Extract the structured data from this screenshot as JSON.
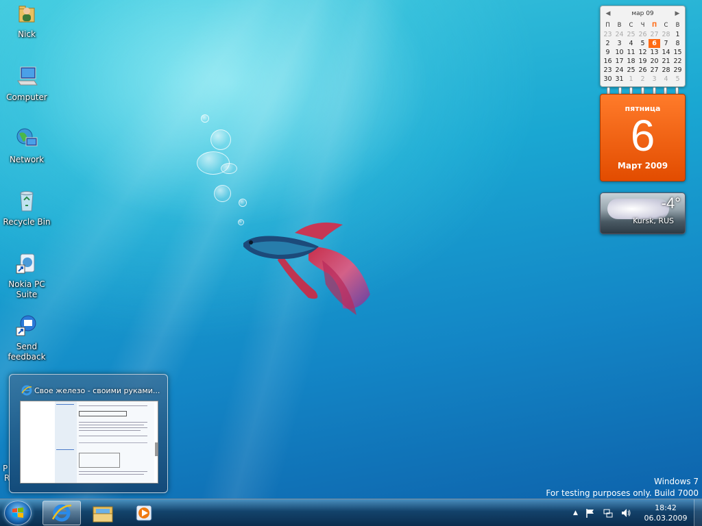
{
  "desktop": {
    "icons": [
      {
        "label": "Nick"
      },
      {
        "label": "Computer"
      },
      {
        "label": "Network"
      },
      {
        "label": "Recycle Bin"
      },
      {
        "label": "Nokia PC Suite"
      },
      {
        "label": "Send feedback"
      }
    ],
    "partial_label_1": "P",
    "partial_label_2": "R"
  },
  "calendar": {
    "month_label": "мар 09",
    "weekdays": [
      "П",
      "В",
      "С",
      "Ч",
      "П",
      "С",
      "В"
    ],
    "weeks": [
      [
        "23",
        "24",
        "25",
        "26",
        "27",
        "28",
        "1"
      ],
      [
        "2",
        "3",
        "4",
        "5",
        "6",
        "7",
        "8"
      ],
      [
        "9",
        "10",
        "11",
        "12",
        "13",
        "14",
        "15"
      ],
      [
        "16",
        "17",
        "18",
        "19",
        "20",
        "21",
        "22"
      ],
      [
        "23",
        "24",
        "25",
        "26",
        "27",
        "28",
        "29"
      ],
      [
        "30",
        "31",
        "1",
        "2",
        "3",
        "4",
        "5"
      ]
    ],
    "today": "6",
    "day_card": {
      "weekday": "пятница",
      "day": "6",
      "month_year": "Март 2009"
    },
    "accent_color": "#ff6a13"
  },
  "weather": {
    "temperature": "-4°",
    "city": "Kursk, RUS"
  },
  "preview": {
    "title": "Свое железо - своими руками..."
  },
  "watermark": {
    "line1": "Windows 7",
    "line2": "For testing purposes only. Build 7000"
  },
  "taskbar": {
    "buttons": [
      {
        "name": "internet-explorer",
        "active": true
      },
      {
        "name": "windows-explorer",
        "active": false
      },
      {
        "name": "media-player",
        "active": false
      }
    ],
    "tray_icons": [
      "show-hidden-icon",
      "action-center-flag-icon",
      "network-icon",
      "volume-icon"
    ],
    "show_hidden": "▲",
    "time": "18:42",
    "date": "06.03.2009"
  }
}
